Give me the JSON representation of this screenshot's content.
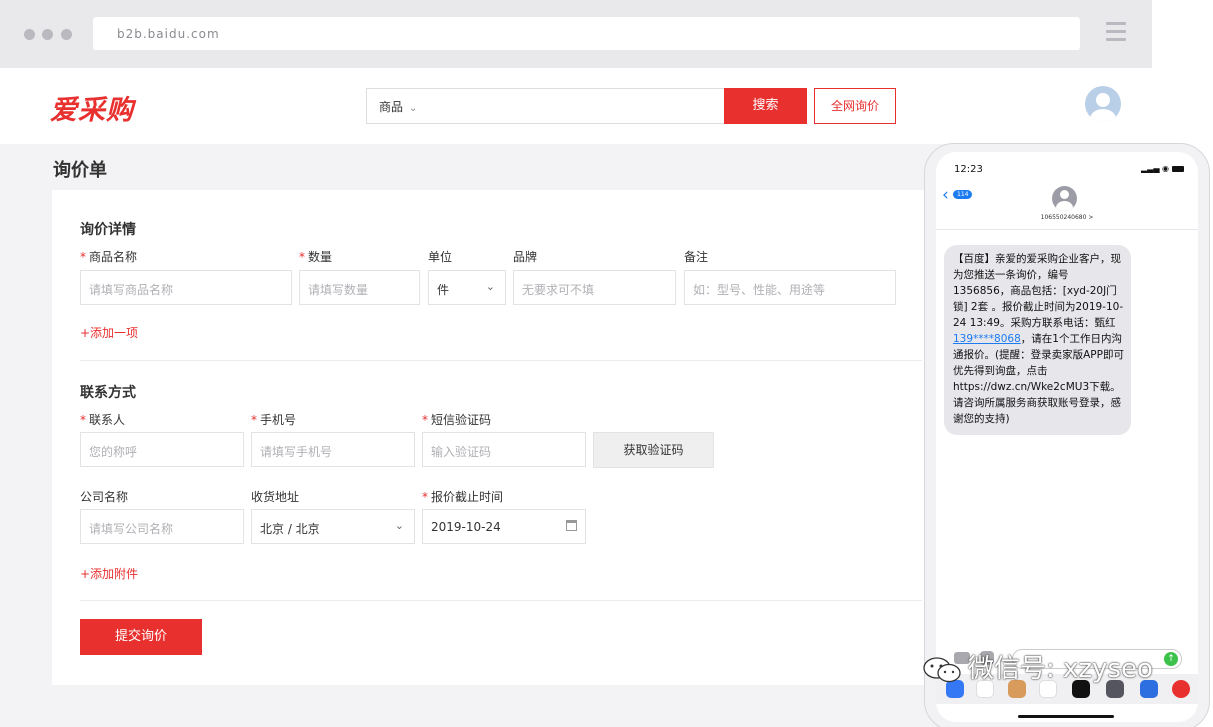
{
  "browser": {
    "url": "b2b.baidu.com"
  },
  "header": {
    "logo": "爱采购",
    "search_category": "商品",
    "search_button": "搜索",
    "all_inquiry_button": "全网询价"
  },
  "page_title": "询价单",
  "inquiry": {
    "section_title": "询价详情",
    "labels": {
      "product_name": "商品名称",
      "quantity": "数量",
      "unit": "单位",
      "brand": "品牌",
      "note": "备注"
    },
    "placeholders": {
      "product_name": "请填写商品名称",
      "quantity": "请填写数量",
      "brand": "无要求可不填",
      "note": "如：型号、性能、用途等"
    },
    "unit_value": "件",
    "add_item": "+添加一项"
  },
  "contact": {
    "section_title": "联系方式",
    "labels": {
      "contact_person": "联系人",
      "phone": "手机号",
      "sms_code": "短信验证码",
      "company": "公司名称",
      "address": "收货地址",
      "deadline": "报价截止时间"
    },
    "placeholders": {
      "contact_person": "您的称呼",
      "phone": "请填写手机号",
      "sms_code": "输入验证码",
      "company": "请填写公司名称"
    },
    "get_code_button": "获取验证码",
    "address_value": "北京 / 北京",
    "deadline_value": "2019-10-24",
    "add_attachment": "+添加附件"
  },
  "submit_button": "提交询价",
  "phone": {
    "time": "12:23",
    "back_badge": "114",
    "contact_number": "106550240680 >",
    "message_pre": "【百度】亲爱的爱采购企业客户，现为您推送一条询价，编号1356856，商品包括：[xyd-20J门锁] 2套 。报价截止时间为2019-10-24 13:49。采购方联系电话：甄红 ",
    "message_link": "139****8068",
    "message_post": "，请在1个工作日内沟通报价。(提醒：登录卖家版APP即可优先得到询盘，点击https://dwz.cn/Wke2cMU3下载。请咨询所属服务商获取账号登录，感谢您的支持)"
  },
  "watermark": "微信号: xzyseo",
  "colors": {
    "accent": "#e8302f",
    "link": "#1d7cf2"
  }
}
